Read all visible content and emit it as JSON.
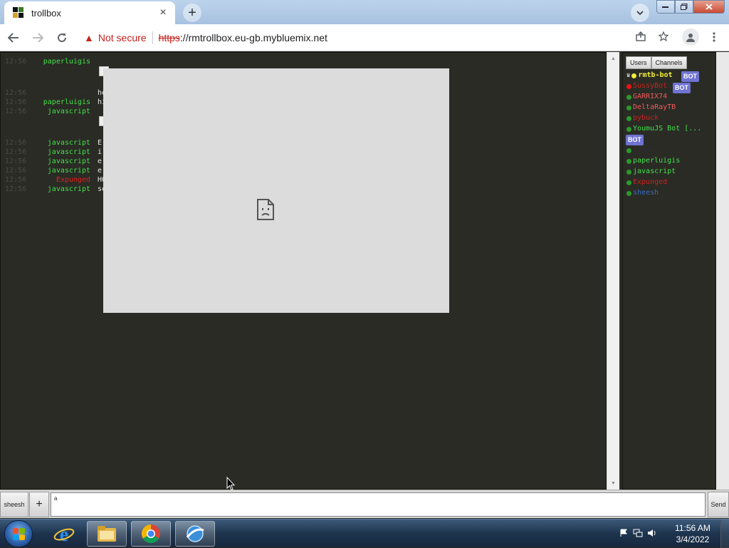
{
  "browser": {
    "tab_title": "trollbox",
    "tab_close": "×",
    "new_tab": "+",
    "security_label": "Not secure",
    "url_scheme": "https",
    "url_rest": "://rmtrollbox.eu-gb.mybluemix.net",
    "icons": [
      "back-icon",
      "forward-icon",
      "reload-icon",
      "warning-icon",
      "share-icon",
      "star-icon",
      "profile-icon",
      "menu-icon"
    ]
  },
  "chat": {
    "messages": [
      {
        "time": "12:56",
        "nick": "paperluigis",
        "color": "#43e04a",
        "text": ""
      },
      {
        "time": "12:56",
        "nick": "ZTham",
        "color": "#2d2d2d",
        "text": "he"
      },
      {
        "time": "12:56",
        "nick": "paperluigis",
        "color": "#43e04a",
        "text": "hi"
      },
      {
        "time": "12:56",
        "nick": "javascript",
        "color": "#43e04a",
        "text": ""
      },
      {
        "time": "12:56",
        "nick": "javascript",
        "color": "#43e04a",
        "text": "E"
      },
      {
        "time": "12:56",
        "nick": "javascript",
        "color": "#43e04a",
        "text": "i"
      },
      {
        "time": "12:56",
        "nick": "javascript",
        "color": "#43e04a",
        "text": "e"
      },
      {
        "time": "12:56",
        "nick": "javascript",
        "color": "#43e04a",
        "text": "e"
      },
      {
        "time": "12:56",
        "nick": "Expunged",
        "color": "#e0201d",
        "text": "HO"
      },
      {
        "time": "12:56",
        "nick": "javascript",
        "color": "#43e04a",
        "text": "se"
      }
    ]
  },
  "sidebar": {
    "tabs": [
      "Users",
      "Channels"
    ],
    "bot_label": "BOT",
    "users": [
      {
        "name": "rmtb-bot",
        "color": "#f2ee3a",
        "dot": "#f2ee3a",
        "crown": true,
        "bot": true
      },
      {
        "name": "SussyBot",
        "color": "#c8231f",
        "dot": "#e11",
        "bot": true
      },
      {
        "name": "GARRIX74",
        "color": "#f05a5a",
        "dot": "#2a9b2a"
      },
      {
        "name": "DeltaRayTB",
        "color": "#f05a5a",
        "dot": "#2a9b2a"
      },
      {
        "name": "pybuck",
        "color": "#c8231f",
        "dot": "#2a9b2a"
      },
      {
        "name": "YoumuJS Bot [...",
        "color": "#43e04a",
        "dot": "#2a9b2a",
        "bot": true
      },
      {
        "name": "ZTham",
        "color": "#2d2d2d",
        "dot": "#2a9b2a"
      },
      {
        "name": "paperluigis",
        "color": "#43e04a",
        "dot": "#2a9b2a"
      },
      {
        "name": "javascript",
        "color": "#43e04a",
        "dot": "#2a9b2a"
      },
      {
        "name": "Expunged",
        "color": "#c8231f",
        "dot": "#2a9b2a"
      },
      {
        "name": "sheesh",
        "color": "#3a6ac0",
        "dot": "#2a9b2a"
      }
    ]
  },
  "input": {
    "channel_button": "sheesh",
    "plus_button": "+",
    "value": "a",
    "send_button": "Send"
  },
  "taskbar": {
    "time": "11:56 AM",
    "date": "3/4/2022"
  }
}
